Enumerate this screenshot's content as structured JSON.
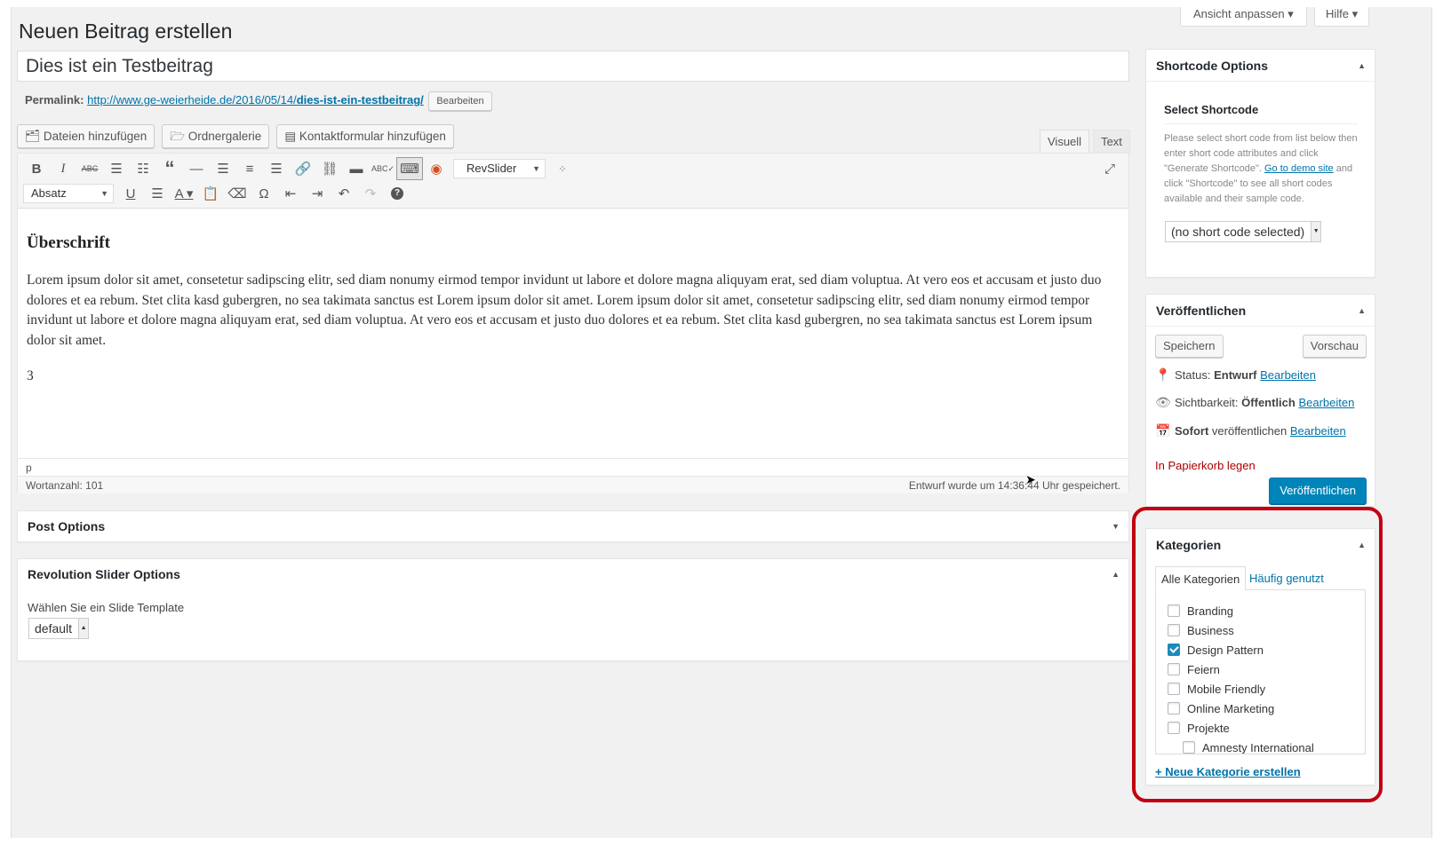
{
  "header": {
    "page_title": "Neuen Beitrag erstellen",
    "screen_options": "Ansicht anpassen",
    "help": "Hilfe"
  },
  "post": {
    "title": "Dies ist ein Testbeitrag",
    "permalink_label": "Permalink:",
    "permalink_base": "http://www.ge-weierheide.de/2016/05/14/",
    "permalink_slug": "dies-ist-ein-testbeitrag/",
    "permalink_edit": "Bearbeiten"
  },
  "media_buttons": [
    "Dateien hinzufügen",
    "Ordnergalerie",
    "Kontaktformular hinzufügen"
  ],
  "editor_tabs": {
    "visual": "Visuell",
    "text": "Text"
  },
  "toolbar": {
    "revslider": "RevSlider",
    "format": "Absatz"
  },
  "content": {
    "heading": "Überschrift",
    "paragraph": "Lorem ipsum dolor sit amet, consetetur sadipscing elitr, sed diam nonumy eirmod tempor invidunt ut labore et dolore magna aliquyam erat, sed diam voluptua. At vero eos et accusam et justo duo dolores et ea rebum. Stet clita kasd gubergren, no sea takimata sanctus est Lorem ipsum dolor sit amet. Lorem ipsum dolor sit amet, consetetur sadipscing elitr, sed diam nonumy eirmod tempor invidunt ut labore et dolore magna aliquyam erat, sed diam voluptua. At vero eos et accusam et justo duo dolores et ea rebum. Stet clita kasd gubergren, no sea takimata sanctus est Lorem ipsum dolor sit amet.",
    "line2": "3"
  },
  "status": {
    "path": "p",
    "word_count": "Wortanzahl: 101",
    "draft_saved": "Entwurf wurde um 14:36:44 Uhr gespeichert."
  },
  "post_options": {
    "title": "Post Options"
  },
  "revslider_options": {
    "title": "Revolution Slider Options",
    "label": "Wählen Sie ein Slide Template",
    "value": "default"
  },
  "shortcode": {
    "title": "Shortcode Options",
    "subtitle": "Select Shortcode",
    "desc_1": "Please select short code from list below then enter short code attributes and click \"Generate Shortcode\".",
    "demo_link": "Go to demo site",
    "desc_2": "and click \"Shortcode\" to see all short codes available and their sample code.",
    "select_value": "(no short code selected)"
  },
  "publish": {
    "title": "Veröffentlichen",
    "save": "Speichern",
    "preview": "Vorschau",
    "status_label": "Status:",
    "status_value": "Entwurf",
    "visibility_label": "Sichtbarkeit:",
    "visibility_value": "Öffentlich",
    "schedule_bold": "Sofort",
    "schedule_text": "veröffentlichen",
    "edit": "Bearbeiten",
    "trash": "In Papierkorb legen",
    "publish_button": "Veröffentlichen"
  },
  "categories": {
    "title": "Kategorien",
    "tab_all": "Alle Kategorien",
    "tab_popular": "Häufig genutzt",
    "add_new": "+ Neue Kategorie erstellen",
    "items": [
      {
        "label": "Branding",
        "checked": false
      },
      {
        "label": "Business",
        "checked": false
      },
      {
        "label": "Design Pattern",
        "checked": true
      },
      {
        "label": "Feiern",
        "checked": false
      },
      {
        "label": "Mobile Friendly",
        "checked": false
      },
      {
        "label": "Online Marketing",
        "checked": false
      },
      {
        "label": "Projekte",
        "checked": false
      },
      {
        "label": "Amnesty International",
        "checked": false
      }
    ]
  },
  "colors": {
    "link": "#0073aa",
    "primary_button": "#0085ba",
    "trash": "#a00",
    "highlight": "#c10010"
  }
}
